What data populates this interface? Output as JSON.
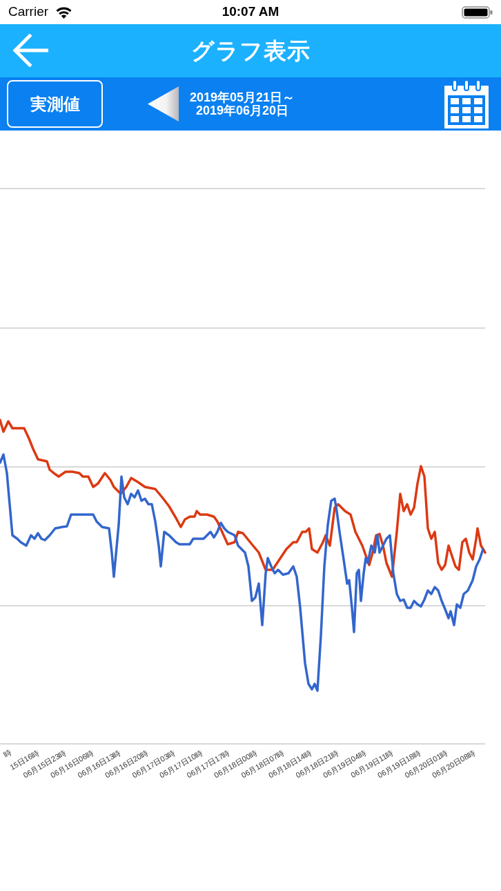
{
  "status_bar": {
    "carrier": "Carrier",
    "time": "10:07 AM"
  },
  "header": {
    "title": "グラフ表示"
  },
  "toolbar": {
    "mode_button": "実測値",
    "date_range": {
      "start": "2019年05月21日～",
      "end": "2019年06月20日"
    }
  },
  "chart": {
    "x_labels": [
      "時",
      "15日16時",
      "06月15日23時",
      "06月16日06時",
      "06月16日13時",
      "06月16日20時",
      "06月17日03時",
      "06月17日10時",
      "06月17日17時",
      "06月18日00時",
      "06月18日07時",
      "06月18日14時",
      "06月18日21時",
      "06月19日04時",
      "06月19日11時",
      "06月19日18時",
      "06月20日01時",
      "06月20日08時"
    ]
  }
}
